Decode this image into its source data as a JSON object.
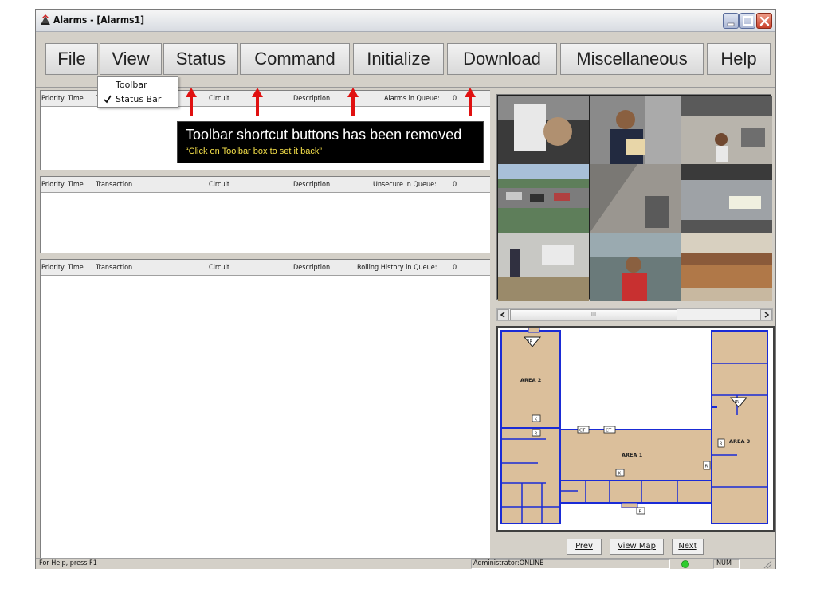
{
  "window": {
    "title": "Alarms - [Alarms1]"
  },
  "menu": {
    "items": [
      "File",
      "View",
      "Status",
      "Command",
      "Initialize",
      "Download",
      "Miscellaneous",
      "Help"
    ]
  },
  "view_menu": {
    "items": [
      {
        "label": "Toolbar",
        "checked": false
      },
      {
        "label": "Status Bar",
        "checked": true
      }
    ]
  },
  "callout": {
    "message": "Toolbar shortcut buttons  has been removed",
    "hint": "“Click on Toolbar box  to set it back”",
    "arrow_color": "#e01010"
  },
  "panes": [
    {
      "columns": [
        "Priority",
        "Time",
        "T",
        "Circuit",
        "Description"
      ],
      "queue_label": "Alarms in Queue:",
      "queue_count": "0"
    },
    {
      "columns": [
        "Priority",
        "Time",
        "Transaction",
        "Circuit",
        "Description"
      ],
      "queue_label": "Unsecure in Queue:",
      "queue_count": "0"
    },
    {
      "columns": [
        "Priority",
        "Time",
        "Transaction",
        "Circuit",
        "Description"
      ],
      "queue_label": "Rolling History in Queue:",
      "queue_count": "0"
    }
  ],
  "scrollbar": {
    "grip": "III"
  },
  "map": {
    "labels": {
      "area1": "AREA 1",
      "area2": "AREA 2",
      "area3": "AREA 3",
      "ir": "IR",
      "r": "R",
      "k": "K",
      "ct": "CT"
    },
    "floor_color": "#dbbf9b",
    "wall_color": "#1a2bd6"
  },
  "map_nav": {
    "prev": "Prev",
    "view_map": "View Map",
    "next": "Next"
  },
  "statusbar": {
    "help": "For Help, press F1",
    "user": "Administrator:ONLINE",
    "num": "NUM",
    "online_color": "#2ecc2e"
  }
}
